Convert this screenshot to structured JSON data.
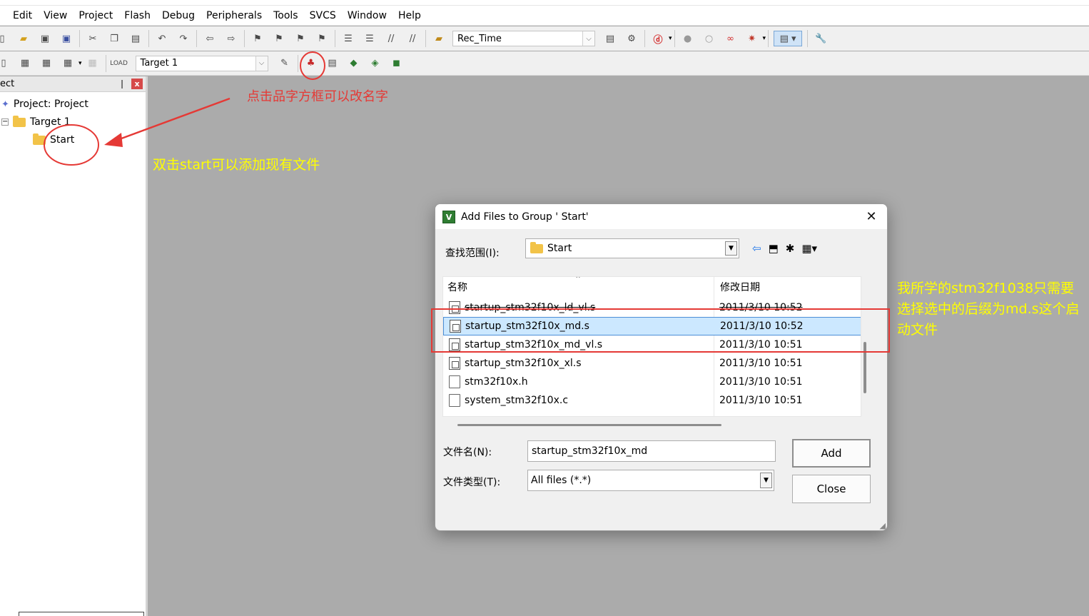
{
  "menu": [
    "Edit",
    "View",
    "Project",
    "Flash",
    "Debug",
    "Peripherals",
    "Tools",
    "SVCS",
    "Window",
    "Help"
  ],
  "toolbar": {
    "rec_combo_value": "Rec_Time",
    "target_combo_value": "Target 1"
  },
  "project_pane": {
    "header": "ect",
    "root": "Project: Project",
    "target": "Target 1",
    "group": "Start",
    "pin_glyph": "❘",
    "close_glyph": "x"
  },
  "annotations": {
    "rename_hint": "点击品字方框可以改名字",
    "add_hint": "双击start可以添加现有文件",
    "startup_hint": "我所学的stm32f1038只需要选择选中的后缀为md.s这个启动文件"
  },
  "dialog": {
    "title": "Add Files to Group ' Start'",
    "look_in_label": "查找范围(I):",
    "look_in_value": "Start",
    "columns": {
      "name": "名称",
      "date": "修改日期"
    },
    "files": [
      {
        "name": "startup_stm32f10x_ld_vl.s",
        "date": "2011/3/10 10:52",
        "icon": "asm"
      },
      {
        "name": "startup_stm32f10x_md.s",
        "date": "2011/3/10 10:52",
        "icon": "asm"
      },
      {
        "name": "startup_stm32f10x_md_vl.s",
        "date": "2011/3/10 10:51",
        "icon": "asm"
      },
      {
        "name": "startup_stm32f10x_xl.s",
        "date": "2011/3/10 10:51",
        "icon": "asm"
      },
      {
        "name": "stm32f10x.h",
        "date": "2011/3/10 10:51",
        "icon": "plain"
      },
      {
        "name": "system_stm32f10x.c",
        "date": "2011/3/10 10:51",
        "icon": "plain"
      }
    ],
    "selected_index": 1,
    "file_name_label": "文件名(N):",
    "file_name_value": "startup_stm32f10x_md",
    "file_type_label": "文件类型(T):",
    "file_type_value": "All files (*.*)",
    "add_label": "Add",
    "close_label": "Close"
  },
  "colors": {
    "annotation_red": "#e53935",
    "annotation_yellow": "#ffff00",
    "selection": "#cce8ff",
    "workspace": "#ababab"
  }
}
